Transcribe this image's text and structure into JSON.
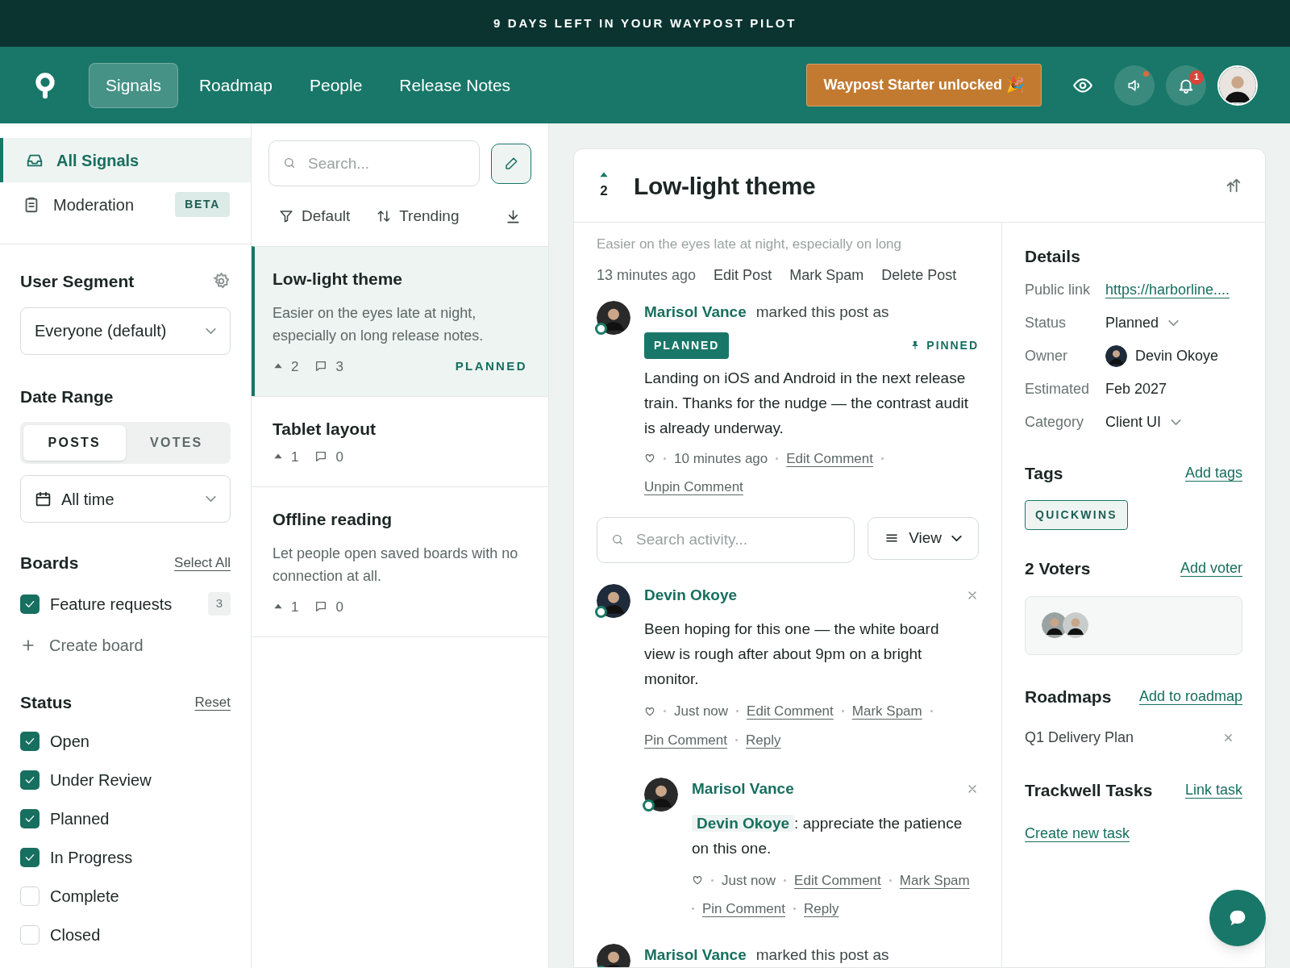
{
  "banner": {
    "text": "9 DAYS LEFT IN YOUR WAYPOST PILOT"
  },
  "nav": {
    "tabs": [
      {
        "label": "Signals",
        "selected": true
      },
      {
        "label": "Roadmap",
        "selected": false
      },
      {
        "label": "People",
        "selected": false
      },
      {
        "label": "Release Notes",
        "selected": false
      }
    ],
    "upgrade_button": "Waypost Starter unlocked 🎉",
    "announcements_unread": true,
    "notification_count": "1"
  },
  "sidebar": {
    "nav_items": [
      {
        "label": "All Signals",
        "selected": true
      },
      {
        "label": "Moderation",
        "selected": false,
        "badge": "BETA"
      }
    ],
    "user_segment": {
      "title": "User Segment",
      "value": "Everyone (default)"
    },
    "date_range": {
      "title": "Date Range",
      "toggle": [
        {
          "label": "POSTS",
          "selected": true
        },
        {
          "label": "VOTES",
          "selected": false
        }
      ],
      "value": "All time"
    },
    "boards": {
      "title": "Boards",
      "action": "Select All",
      "items": [
        {
          "label": "Feature requests",
          "checked": true,
          "count": "3"
        }
      ],
      "create": "Create board"
    },
    "status": {
      "title": "Status",
      "action": "Reset",
      "items": [
        {
          "label": "Open",
          "checked": true
        },
        {
          "label": "Under Review",
          "checked": true
        },
        {
          "label": "Planned",
          "checked": true
        },
        {
          "label": "In Progress",
          "checked": true
        },
        {
          "label": "Complete",
          "checked": false
        },
        {
          "label": "Closed",
          "checked": false
        }
      ]
    }
  },
  "post_list": {
    "search_placeholder": "Search...",
    "filter": "Default",
    "sort": "Trending",
    "posts": [
      {
        "title": "Low-light theme",
        "description": "Easier on the eyes late at night, especially on long release notes.",
        "votes": "2",
        "comments": "3",
        "status": "PLANNED",
        "selected": true
      },
      {
        "title": "Tablet layout",
        "votes": "1",
        "comments": "0",
        "selected": false
      },
      {
        "title": "Offline reading",
        "description": "Let people open saved boards with no connection at all.",
        "votes": "1",
        "comments": "0",
        "selected": false
      }
    ]
  },
  "post": {
    "votes": "2",
    "title": "Low-light theme",
    "excerpt": "Easier on the eyes late at night, especially on long",
    "time": "13 minutes ago",
    "actions": [
      "Edit Post",
      "Mark Spam",
      "Delete Post"
    ],
    "pinned": {
      "author": "Marisol Vance",
      "text": "marked this post as",
      "badge": "PLANNED",
      "pin_label": "PINNED",
      "body": "Landing on iOS and Android in the next release train. Thanks for the nudge — the contrast audit is already underway.",
      "time": "10 minutes ago",
      "links": [
        "Edit Comment",
        "Unpin Comment"
      ]
    },
    "activity_search": {
      "placeholder": "Search activity...",
      "view": "View"
    },
    "activity": [
      {
        "kind": "comment",
        "author": "Devin Okoye",
        "body": "Been hoping for this one — the white board view is rough after about 9pm on a bright monitor.",
        "time": "Just now",
        "links": [
          "Edit Comment",
          "Mark Spam",
          "Pin Comment",
          "Reply"
        ],
        "children": [
          {
            "kind": "comment",
            "author": "Marisol Vance",
            "mention": "Devin Okoye",
            "body": ": appreciate the patience on this one.",
            "time": "Just now",
            "links": [
              "Edit Comment",
              "Mark Spam",
              "Pin Comment",
              "Reply"
            ]
          }
        ]
      },
      {
        "kind": "status",
        "author": "Marisol Vance",
        "text": "marked this post as"
      }
    ]
  },
  "details": {
    "title": "Details",
    "rows": [
      {
        "label": "Public link",
        "value": "https://harborline....",
        "kind": "link"
      },
      {
        "label": "Status",
        "value": "Planned",
        "kind": "select"
      },
      {
        "label": "Owner",
        "value": "Devin Okoye",
        "kind": "person"
      },
      {
        "label": "Estimated",
        "value": "Feb 2027",
        "kind": "text"
      },
      {
        "label": "Category",
        "value": "Client UI",
        "kind": "select"
      }
    ],
    "tags": {
      "title": "Tags",
      "action": "Add tags",
      "items": [
        "QUICKWINS"
      ]
    },
    "voters": {
      "title": "2 Voters",
      "action": "Add voter"
    },
    "roadmaps": {
      "title": "Roadmaps",
      "action": "Add to roadmap",
      "items": [
        "Q1 Delivery Plan"
      ]
    },
    "tasks": {
      "title": "Trackwell Tasks",
      "action": "Link task",
      "create": "Create new task"
    }
  }
}
